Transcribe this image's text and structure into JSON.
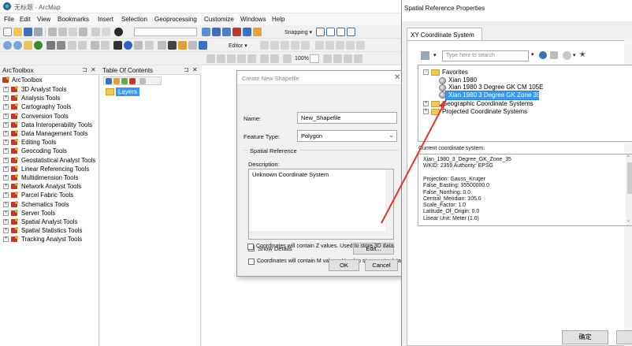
{
  "arcmap": {
    "title": "无标题 - ArcMap",
    "menu": [
      "File",
      "Edit",
      "View",
      "Bookmarks",
      "Insert",
      "Selection",
      "Geoprocessing",
      "Customize",
      "Windows",
      "Help"
    ],
    "snapping_label": "Snapping ▾",
    "editor_label": "Editor ▾",
    "zoom_value": "100%"
  },
  "toolbox": {
    "header": "ArcToolbox",
    "root": "ArcToolbox",
    "items": [
      "3D Analyst Tools",
      "Analysis Tools",
      "Cartography Tools",
      "Conversion Tools",
      "Data Interoperability Tools",
      "Data Management Tools",
      "Editing Tools",
      "Geocoding Tools",
      "Geostatistical Analyst Tools",
      "Linear Referencing Tools",
      "Multidimension Tools",
      "Network Analyst Tools",
      "Parcel Fabric Tools",
      "Schematics Tools",
      "Server Tools",
      "Spatial Analyst Tools",
      "Spatial Statistics Tools",
      "Tracking Analyst Tools"
    ]
  },
  "toc": {
    "header": "Table Of Contents",
    "layers_label": "Layers"
  },
  "create_shapefile": {
    "title": "Create New Shapefile",
    "name_label": "Name:",
    "name_value": "New_Shapefile",
    "feature_type_label": "Feature Type:",
    "feature_type_value": "Polygon",
    "spatial_reference_label": "Spatial Reference",
    "description_label": "Description:",
    "description_value": "Unknown Coordinate System",
    "show_details_label": "Show Details",
    "edit_button": "Edit...",
    "m_values_label": "Coordinates will contain M values. Used to store route data.",
    "z_values_label": "Coordinates will contain Z values. Used to store 3D data.",
    "ok_button": "OK",
    "cancel_button": "Cancel"
  },
  "spatial_ref": {
    "title": "Spatial Reference Properties",
    "tab": "XY Coordinate System",
    "search_placeholder": "Type here to search",
    "tree": {
      "favorites": "Favorites",
      "fav_items": [
        "Xian 1980",
        "Xian 1980 3 Degree GK CM 105E",
        "Xian 1980 3 Degree GK Zone 35"
      ],
      "geographic": "Geographic Coordinate Systems",
      "projected": "Projected Coordinate Systems"
    },
    "current_label": "Current coordinate system:",
    "current_lines": [
      "Xian_1980_3_Degree_GK_Zone_35",
      "WKID: 2359 Authority: EPSG",
      "",
      "Projection: Gauss_Kruger",
      "False_Easting: 35500000.0",
      "False_Northing: 0.0",
      "Central_Meridian: 105.0",
      "Scale_Factor: 1.0",
      "Latitude_Of_Origin: 0.0",
      "Linear Unit: Meter (1.0)"
    ],
    "ok_button": "确定"
  },
  "colors": {
    "selection": "#3399ff",
    "arrow": "#e8312f",
    "toolbox_icon": "#c0392b"
  }
}
